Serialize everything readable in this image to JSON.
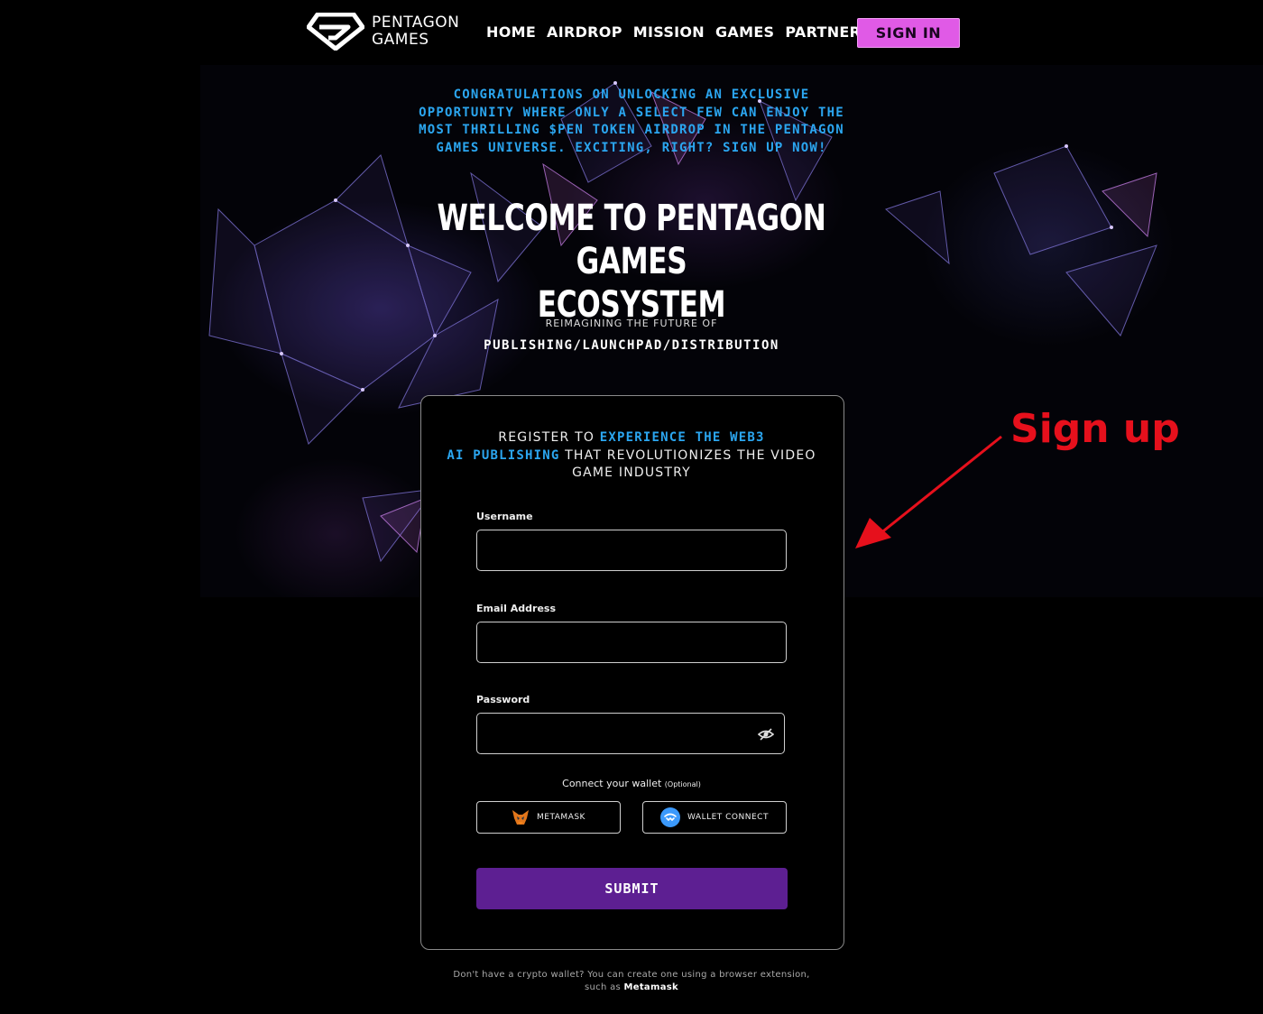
{
  "nav": {
    "logo_text": "PENTAGON\nGAMES",
    "links": [
      "HOME",
      "AIRDROP",
      "MISSION",
      "GAMES",
      "PARTNERS"
    ],
    "signin_label": "SIGN IN"
  },
  "hero": {
    "congrats": "CONGRATULATIONS ON UNLOCKING AN EXCLUSIVE OPPORTUNITY WHERE ONLY A SELECT FEW CAN ENJOY THE MOST THRILLING $PEN TOKEN AIRDROP IN THE PENTAGON GAMES UNIVERSE. EXCITING, RIGHT? SIGN UP NOW!",
    "welcome_line1": "WELCOME TO PENTAGON GAMES",
    "welcome_line2": "ECOSYSTEM",
    "reimagine": "REIMAGINING THE FUTURE OF",
    "pub": "PUBLISHING/LAUNCHPAD/DISTRIBUTION"
  },
  "form": {
    "intro_pre": "REGISTER TO ",
    "intro_hl1": "EXPERIENCE THE WEB3",
    "intro_hl2": "AI PUBLISHING",
    "intro_post": " THAT REVOLUTIONIZES THE VIDEO GAME INDUSTRY",
    "username_label": "Username",
    "username_value": "",
    "email_label": "Email Address",
    "email_value": "",
    "password_label": "Password",
    "password_value": "",
    "wallet_title": "Connect your wallet",
    "wallet_optional": "(Optional)",
    "metamask_label": "METAMASK",
    "walletconnect_label": "WALLET CONNECT",
    "submit_label": "SUBMIT",
    "note_text": "Don't have a crypto wallet? You can create one using a browser extension, such as ",
    "note_link": "Metamask"
  },
  "annotation": {
    "text": "Sign up",
    "color": "#e6101c"
  },
  "colors": {
    "accent_blue": "#2ba6f0",
    "signin_pink": "#e05ae6",
    "submit_purple": "#5d1f92"
  },
  "icons": [
    "pentagon-games-logo",
    "eye-off-icon",
    "metamask-fox-icon",
    "walletconnect-icon",
    "red-arrow"
  ]
}
